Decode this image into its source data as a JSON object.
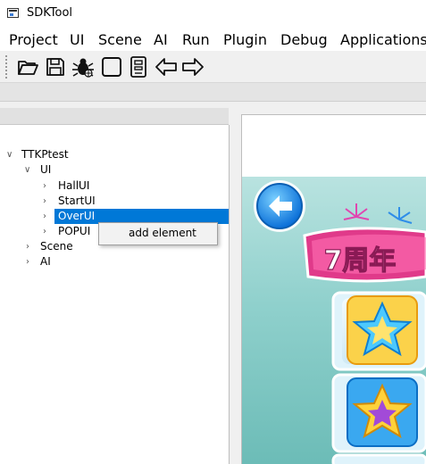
{
  "window": {
    "title": "SDKTool"
  },
  "menu": [
    "Project",
    "UI",
    "Scene",
    "AI",
    "Run",
    "Plugin",
    "Debug",
    "Applications"
  ],
  "toolbar": {
    "icons": [
      "open-folder-icon",
      "save-icon",
      "bug-icon",
      "square-icon",
      "document-icon",
      "arrow-left-icon",
      "arrow-right-icon"
    ]
  },
  "tree": {
    "root": "TTKPtest",
    "ui": "UI",
    "ui_children": [
      "HallUI",
      "StartUI",
      "OverUI",
      "POPUI"
    ],
    "scene": "Scene",
    "ai": "AI",
    "selected": "OverUI"
  },
  "context_menu": {
    "items": [
      "add element"
    ]
  },
  "game": {
    "banner_text": "7周年"
  },
  "colors": {
    "selection": "#0078d7",
    "accent_pink": "#e03a8a",
    "teal": "#8fd0cc"
  }
}
